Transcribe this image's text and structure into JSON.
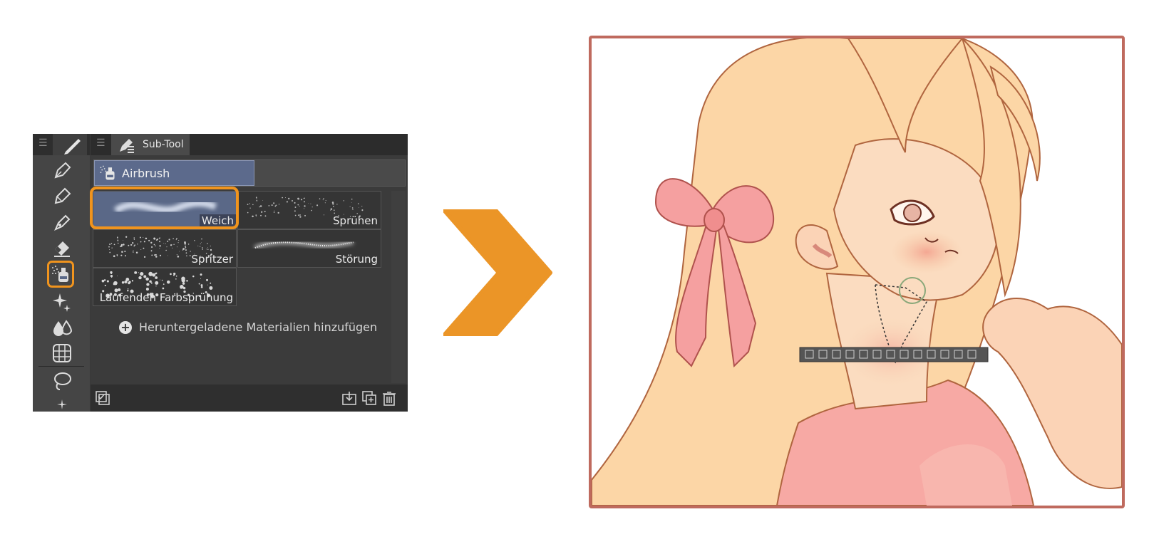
{
  "subtool_panel": {
    "tab_title": "Sub-Tool",
    "group_name": "Airbrush",
    "brushes": [
      {
        "label": "Weich",
        "selected": true
      },
      {
        "label": "Sprühen",
        "selected": false
      },
      {
        "label": "Spritzer",
        "selected": false
      },
      {
        "label": "Störung",
        "selected": false
      },
      {
        "label": "Laufenden Farbsprühung",
        "selected": false
      }
    ],
    "add_materials_label": "Heruntergeladene Materialien hinzufügen"
  },
  "tools": [
    "pen-icon",
    "pencil-icon",
    "brush-icon",
    "eraser-icon",
    "airbrush-icon",
    "decoration-icon",
    "blend-icon",
    "grid-icon",
    "lasso-icon",
    "more-icon"
  ],
  "colors": {
    "highlight": "#f0941e",
    "frame_border": "#bf6a5e",
    "selected_brush": "#5a6887"
  }
}
